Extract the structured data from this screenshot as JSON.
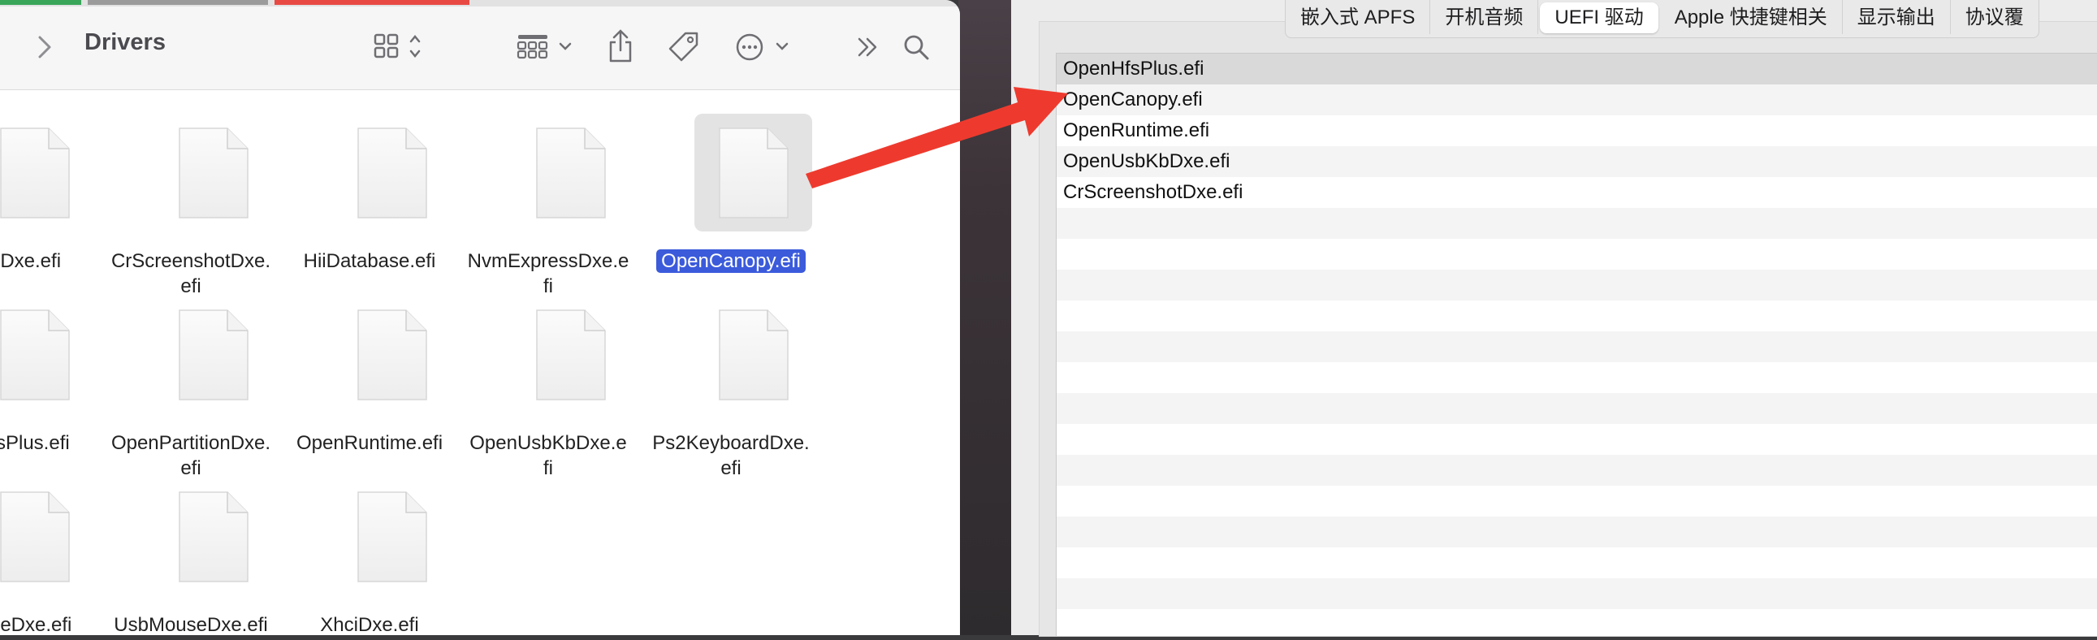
{
  "finder": {
    "title": "Drivers",
    "files": [
      {
        "name": "udioDxe.efi",
        "selected": false
      },
      {
        "name": "CrScreenshotDxe.\nefi",
        "selected": false
      },
      {
        "name": "HiiDatabase.efi",
        "selected": false
      },
      {
        "name": "NvmExpressDxe.e\nfi",
        "selected": false
      },
      {
        "name": "OpenCanopy.efi",
        "selected": true
      },
      {
        "name": "enHfsPlus.efi",
        "selected": false
      },
      {
        "name": "OpenPartitionDxe.\nefi",
        "selected": false
      },
      {
        "name": "OpenRuntime.efi",
        "selected": false
      },
      {
        "name": "OpenUsbKbDxe.e\nfi",
        "selected": false
      },
      {
        "name": "Ps2KeyboardDxe.\nefi",
        "selected": false
      },
      {
        "name": "MouseDxe.efi",
        "selected": false
      },
      {
        "name": "UsbMouseDxe.efi",
        "selected": false
      },
      {
        "name": "XhciDxe.efi",
        "selected": false
      }
    ]
  },
  "config": {
    "tabs": [
      "嵌入式 APFS",
      "开机音频",
      "UEFI 驱动",
      "Apple 快捷键相关",
      "显示输出",
      "协议覆"
    ],
    "active_tab": 2,
    "drivers": [
      "OpenHfsPlus.efi",
      "OpenCanopy.efi",
      "OpenRuntime.efi",
      "OpenUsbKbDxe.efi",
      "CrScreenshotDxe.efi"
    ],
    "selected_row": 0
  },
  "colors": {
    "selection": "#3b5bdb",
    "arrow": "#ee3a2e"
  }
}
